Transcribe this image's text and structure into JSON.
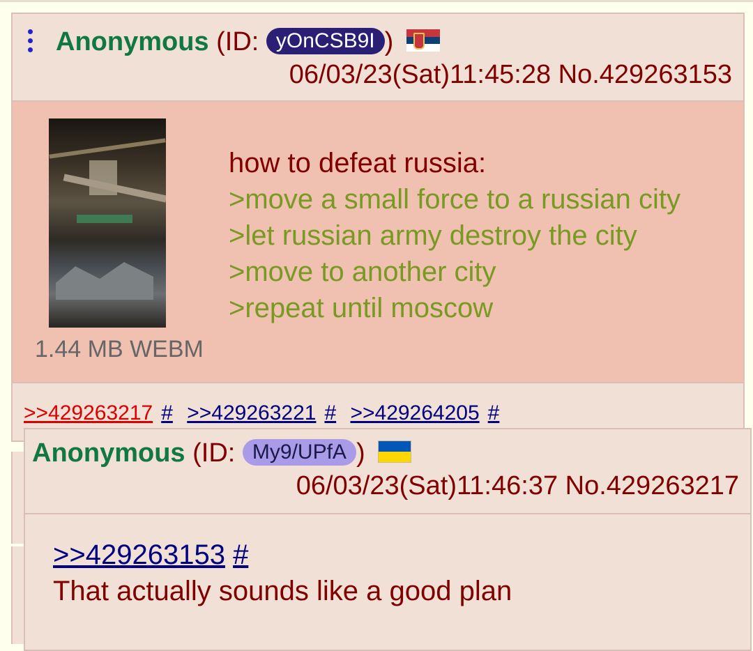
{
  "op_post": {
    "name": "Anonymous",
    "id_prefix": "(ID: ",
    "poster_id": "yOnCSB9I",
    "id_suffix": ")",
    "flag_icon": "serbia-flag-icon",
    "datetime": "06/03/23(Sat)11:45:28",
    "post_no": "No.429263153",
    "file_info": "1.44 MB WEBM",
    "comment_lines": [
      "how to defeat russia:",
      ">move a small force to a russian city",
      ">let russian army destroy the city",
      ">move to another city",
      ">repeat until moscow"
    ],
    "backlinks": [
      ">>429263217",
      "#",
      ">>429263221",
      "#",
      ">>429264205",
      "#"
    ]
  },
  "reply_preview": {
    "name": "Anonymous",
    "id_prefix": "(ID: ",
    "poster_id": "My9/UPfA",
    "id_suffix": ")",
    "flag_icon": "ukraine-flag-icon",
    "datetime": "06/03/23(Sat)11:46:37",
    "post_no": "No.429263217",
    "quote_link": ">>429263153",
    "quote_hash": "#",
    "comment": "That actually sounds like a good plan"
  },
  "colors": {
    "name_green": "#117743",
    "text_maroon": "#800000",
    "greentext": "#789922",
    "link_blue": "#000080",
    "highlight_red": "#DD0000",
    "post_bg": "#F0E0D6",
    "highlighted_post_bg": "#F0C0B0"
  }
}
